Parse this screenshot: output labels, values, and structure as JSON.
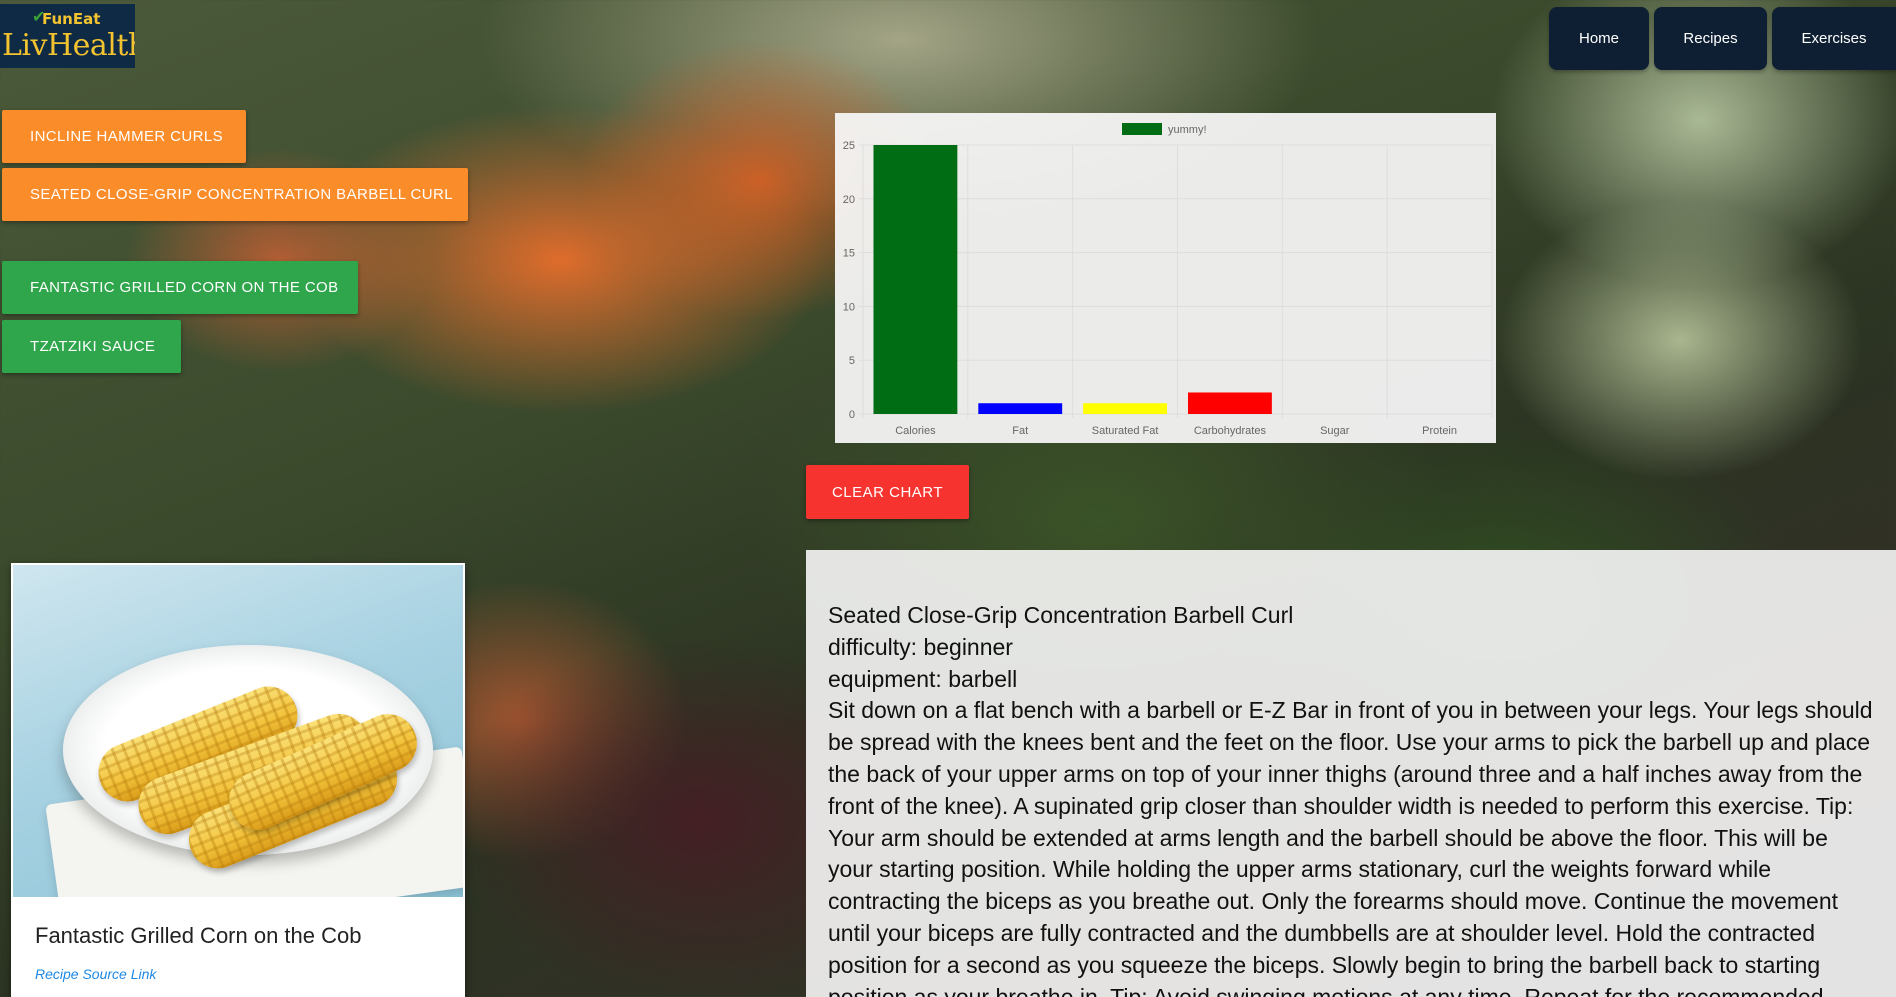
{
  "logo": {
    "top": "FunEat",
    "main": "LivHealthy"
  },
  "nav": {
    "home": "Home",
    "recipes": "Recipes",
    "exercises": "Exercises"
  },
  "exercise_buttons": [
    "INCLINE HAMMER CURLS",
    "SEATED CLOSE-GRIP CONCENTRATION BARBELL CURL"
  ],
  "recipe_buttons": [
    "FANTASTIC GRILLED CORN ON THE COB",
    "TZATZIKI SAUCE"
  ],
  "clear_button": "CLEAR CHART",
  "chart_data": {
    "type": "bar",
    "categories": [
      "Calories",
      "Fat",
      "Saturated Fat",
      "Carbohydrates",
      "Sugar",
      "Protein"
    ],
    "series": [
      {
        "name": "yummy!",
        "values": [
          25,
          1,
          1,
          2,
          0,
          0
        ]
      }
    ],
    "colors": [
      "#006d14",
      "#0000ff",
      "#ffff00",
      "#ff0000",
      "#808080",
      "#808080"
    ],
    "legend_color": "#006d14",
    "ylim": [
      0,
      25
    ],
    "yticks": [
      0,
      5,
      10,
      15,
      20,
      25
    ],
    "grid": true,
    "legend_position": "top"
  },
  "recipe_card": {
    "title": "Fantastic Grilled Corn on the Cob",
    "link_text": "Recipe Source Link"
  },
  "exercise_detail": {
    "name": "Seated Close-Grip Concentration Barbell Curl",
    "difficulty": "difficulty: beginner",
    "equipment": "equipment: barbell",
    "instructions": "Sit down on a flat bench with a barbell or E-Z Bar in front of you in between your legs. Your legs should be spread with the knees bent and the feet on the floor. Use your arms to pick the barbell up and place the back of your upper arms on top of your inner thighs (around three and a half inches away from the front of the knee). A supinated grip closer than shoulder width is needed to perform this exercise. Tip: Your arm should be extended at arms length and the barbell should be above the floor. This will be your starting position. While holding the upper arms stationary, curl the weights forward while contracting the biceps as you breathe out. Only the forearms should move. Continue the movement until your biceps are fully contracted and the dumbbells are at shoulder level. Hold the contracted position for a second as you squeeze the biceps. Slowly begin to bring the barbell back to starting position as your breathe in. Tip: Avoid swinging motions at any time. Repeat for the recommended amount of repetitions. Variations:"
  }
}
